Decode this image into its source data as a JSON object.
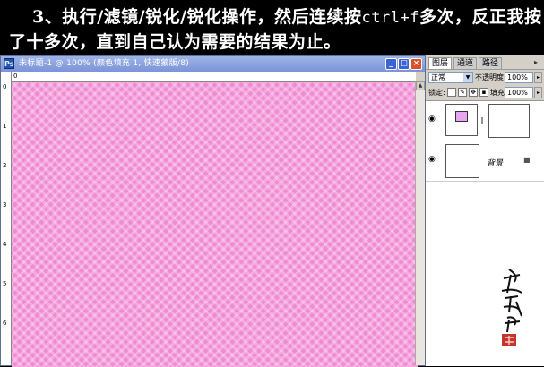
{
  "caption": {
    "line1_a": "3、执行/滤镜/锐化/锐化操作，然后连续按",
    "line1_keys": "ctrl+f",
    "line1_b": "多次，反正我按",
    "line2": "了十多次，直到自己认为需要的结果为止。"
  },
  "document": {
    "app_icon_label": "Ps",
    "title": "未标题-1 @ 100% (颜色填充 1, 快速蒙版/8)",
    "min_glyph": "_",
    "max_glyph": "□",
    "close_glyph": "×",
    "canvas_color": "#f08ad2",
    "ruler_top_ticks": [
      "0"
    ],
    "ruler_left_ticks": [
      "0",
      "1",
      "2",
      "3",
      "4",
      "5",
      "6"
    ]
  },
  "layers_panel": {
    "tabs": [
      "图层",
      "通道",
      "路径"
    ],
    "active_tab": 0,
    "menu_glyph": "▸",
    "blend_mode": "正常",
    "opacity_label": "不透明度:",
    "opacity_value": "100%",
    "lock_label": "锁定:",
    "fill_label": "填充:",
    "fill_value": "100%",
    "layers": [
      {
        "name": "",
        "type": "fill"
      },
      {
        "name": "背景",
        "type": "background"
      }
    ],
    "background_lock_glyph": "🔒",
    "eye_glyph": "👁"
  },
  "colors": {
    "caption_bg": "#000000",
    "caption_text": "#ffffff",
    "titlebar": "#8aa2de",
    "swatch": "#e6a6f0"
  }
}
